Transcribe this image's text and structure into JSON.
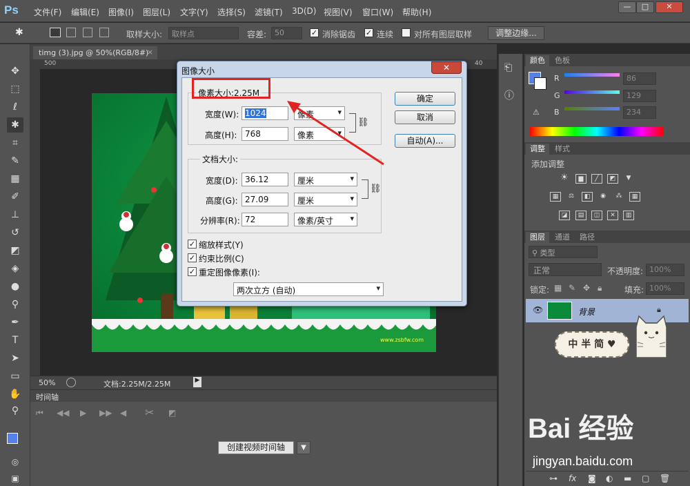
{
  "app": {
    "logo": "Ps",
    "menu": [
      "文件(F)",
      "编辑(E)",
      "图像(I)",
      "图层(L)",
      "文字(Y)",
      "选择(S)",
      "滤镜(T)",
      "3D(D)",
      "视图(V)",
      "窗口(W)",
      "帮助(H)"
    ],
    "window_buttons": [
      "—",
      "□",
      "✕"
    ]
  },
  "options_bar": {
    "sample_size_label": "取样大小:",
    "sample_size_value": "取样点",
    "tolerance_label": "容差:",
    "tolerance_value": "50",
    "antialias_label": "消除锯齿",
    "contiguous_label": "连续",
    "all_layers_label": "对所有图层取样",
    "refine_edge_label": "调整边缘..."
  },
  "document": {
    "tab_title": "timg (3).jpg @ 50%(RGB/8#)",
    "ruler_marks": [
      "500",
      "40"
    ],
    "zoom": "50%",
    "doc_size": "文档:2.25M/2.25M",
    "image_watermark": "www.zsbfw.com"
  },
  "timeline": {
    "title": "时间轴",
    "create_button": "创建视频时间轴"
  },
  "panels": {
    "color": {
      "tabs": [
        "颜色",
        "色板"
      ],
      "channels": [
        {
          "name": "R",
          "value": "86"
        },
        {
          "name": "G",
          "value": "129"
        },
        {
          "name": "B",
          "value": "234"
        }
      ],
      "foreground": "#5681ea"
    },
    "adjustments": {
      "tabs": [
        "调整",
        "样式"
      ],
      "add_label": "添加调整"
    },
    "layers": {
      "tabs": [
        "图层",
        "通道",
        "路径"
      ],
      "kind_filter": "类型",
      "blend_mode": "正常",
      "opacity_label": "不透明度:",
      "opacity_value": "100%",
      "lock_label": "锁定:",
      "fill_label": "填充:",
      "fill_value": "100%",
      "layer_name": "背景"
    }
  },
  "dialog": {
    "title": "图像大小",
    "pixel_dimensions": "像素大小:2.25M",
    "width_label": "宽度(W):",
    "width_value": "1024",
    "width_unit": "像素",
    "height_label": "高度(H):",
    "height_value": "768",
    "height_unit": "像素",
    "doc_size_title": "文档大小:",
    "doc_width_label": "宽度(D):",
    "doc_width_value": "36.12",
    "doc_width_unit": "厘米",
    "doc_height_label": "高度(G):",
    "doc_height_value": "27.09",
    "doc_height_unit": "厘米",
    "resolution_label": "分辨率(R):",
    "resolution_value": "72",
    "resolution_unit": "像素/英寸",
    "scale_styles": "缩放样式(Y)",
    "constrain": "约束比例(C)",
    "resample": "重定图像像素(I):",
    "resample_method": "两次立方 (自动)",
    "ok": "确定",
    "cancel": "取消",
    "auto": "自动(A)..."
  },
  "sticker_text": "中 半 简 ♥",
  "watermark": {
    "brand": "Bai 经验",
    "url": "jingyan.baidu.com"
  }
}
